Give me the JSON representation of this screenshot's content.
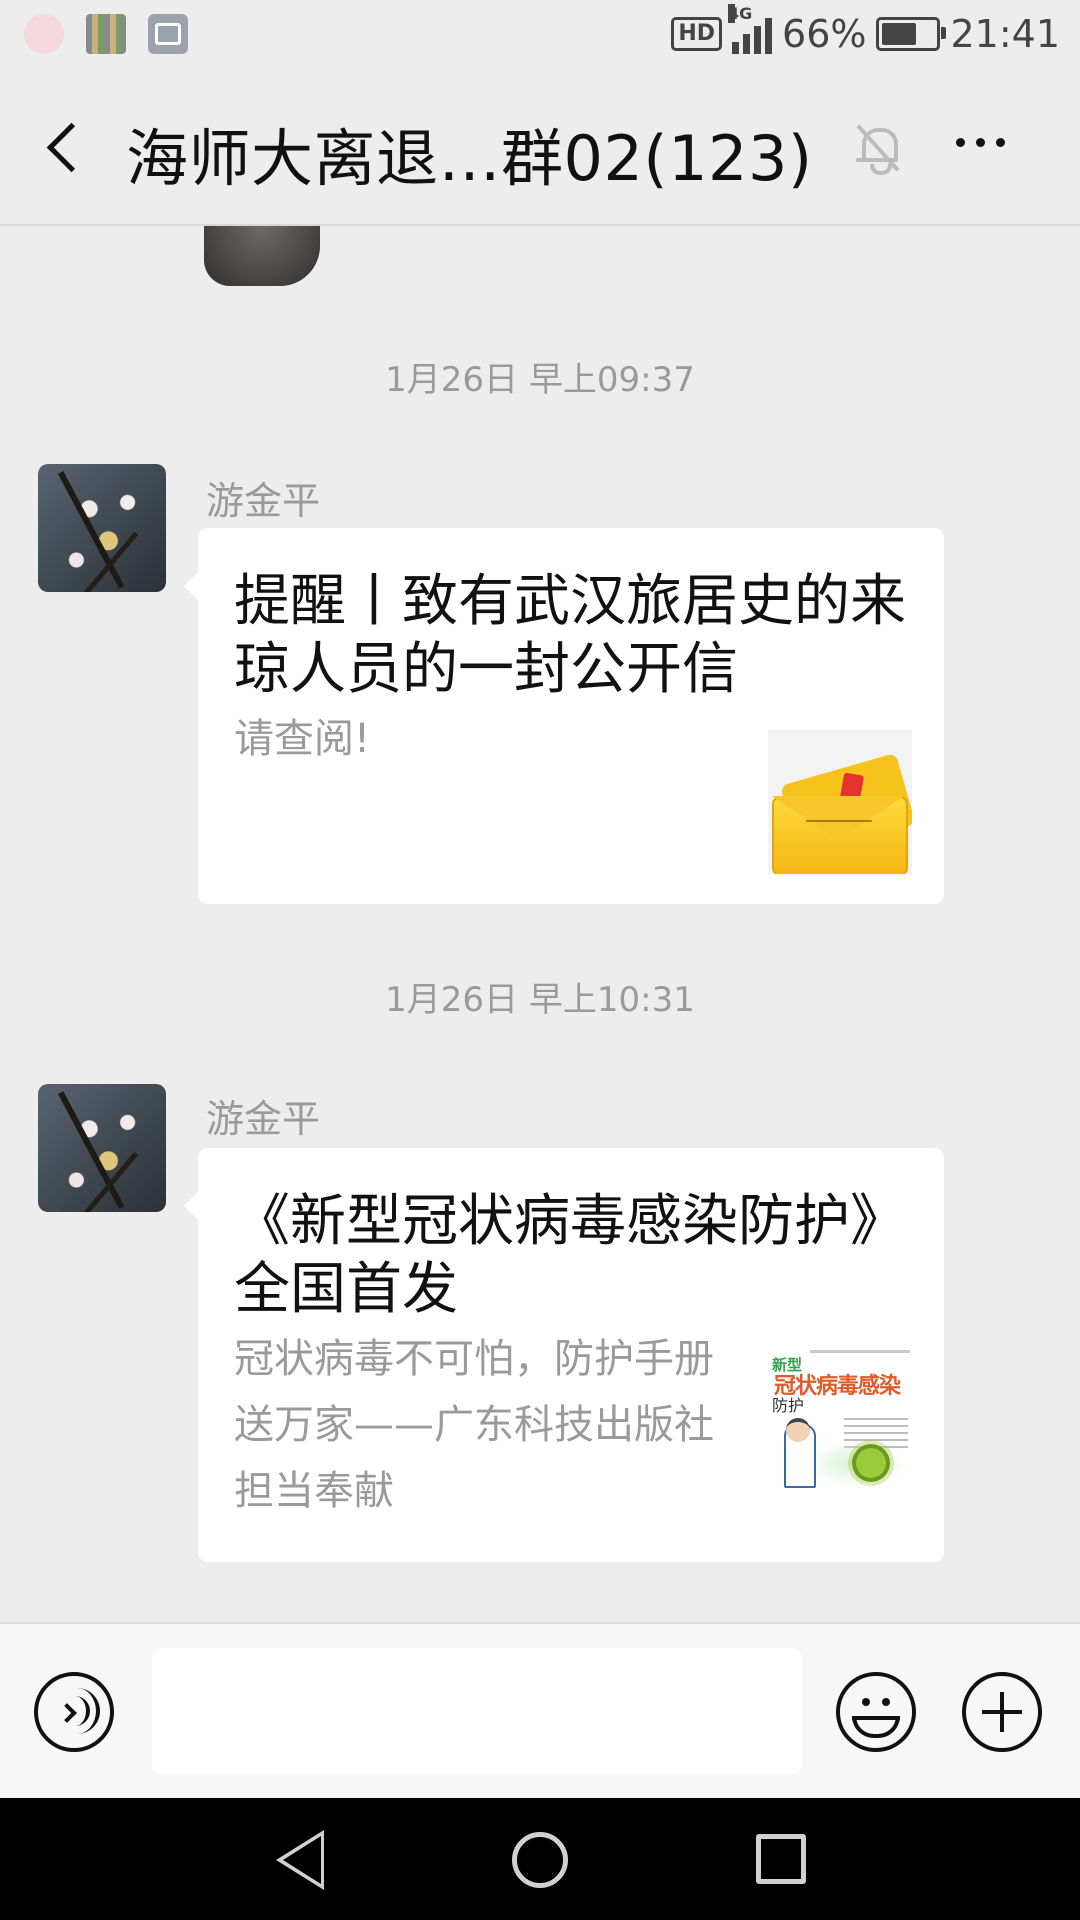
{
  "status_bar": {
    "hd": "HD",
    "network": "4G",
    "battery_percent": "66%",
    "battery_level": 0.66,
    "time": "21:41",
    "left_icons": [
      "app-notification-icon",
      "gallery-notification-icon",
      "image-notification-icon"
    ]
  },
  "header": {
    "title": "海师大离退…群02(123)",
    "icons": [
      "back-icon",
      "mute-bell-icon",
      "more-icon"
    ]
  },
  "messages": [
    {
      "timestamp": "1月26日 早上09:37",
      "sender": "游金平",
      "card_title": "提醒丨致有武汉旅居史的来琼人员的一封公开信",
      "card_desc": "请查阅!",
      "thumbnail": "envelope-thumbnail"
    },
    {
      "timestamp": "1月26日 早上10:31",
      "sender": "游金平",
      "card_title": "《新型冠状病毒感染防护》全国首发",
      "card_desc": "冠状病毒不可怕，防护手册送万家——广东科技出版社担当奉献",
      "thumbnail": "book-cover-thumbnail",
      "thumbnail_text": {
        "line1": "新型",
        "line2": "冠状病毒感染",
        "line3": "防护"
      }
    }
  ],
  "input_bar": {
    "value": "",
    "icons": [
      "voice-icon",
      "emoji-icon",
      "plus-icon"
    ]
  },
  "system_nav": {
    "icons": [
      "nav-back-icon",
      "nav-home-icon",
      "nav-recent-icon"
    ]
  }
}
